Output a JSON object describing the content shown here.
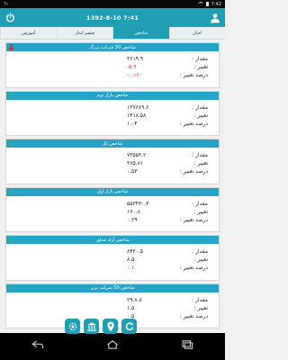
{
  "status": {
    "time": "7:42",
    "notif": "↻"
  },
  "appbar": {
    "title": "1392-8-10 7:41"
  },
  "tabs": [
    {
      "label": "اخبار"
    },
    {
      "label": "شاخص"
    },
    {
      "label": "چشم انداز"
    },
    {
      "label": "آموزش"
    }
  ],
  "labels": {
    "amount": "مقدار :",
    "change": "تغییر :",
    "change_pct": "درصد تغییر :"
  },
  "colors": {
    "accent": "#1f9eb4",
    "up": "#2bb39a",
    "down": "#e8262a"
  },
  "indices": [
    {
      "title": "شاخص 30 شرکت بزرگ",
      "direction": "down",
      "amount": "۳۶۱۹.۹",
      "change": "-۵.۹",
      "change_pct": "-۰.۱۶۰"
    },
    {
      "title": "شاخص بازار دوم",
      "direction": "up",
      "amount": "۱۳۷۶۸۹.۶",
      "change": "۱۴۱۸.۵۸",
      "change_pct": "۱.۰۴"
    },
    {
      "title": "شاخص کل",
      "direction": "up",
      "amount": "۷۳۵۵۳.۲",
      "change": "۳۸۵.۸۱",
      "change_pct": "۰.۵۳"
    },
    {
      "title": "شاخص بازار اول",
      "direction": "up",
      "amount": "۵۵۳۴۳۰.۳",
      "change": "۱۶۰.۸",
      "change_pct": "۰.۲۹"
    },
    {
      "title": "شاخص آزاد شناور",
      "direction": "up",
      "amount": "۸۴۲۰.۵",
      "change": "۸.۵",
      "change_pct": "۰.۱"
    },
    {
      "title": "شاخص 50 شرکت برتر",
      "direction": "up",
      "amount": "۲۹.۸.۸",
      "change": "۱.۵",
      "change_pct": "۰.۵"
    }
  ]
}
